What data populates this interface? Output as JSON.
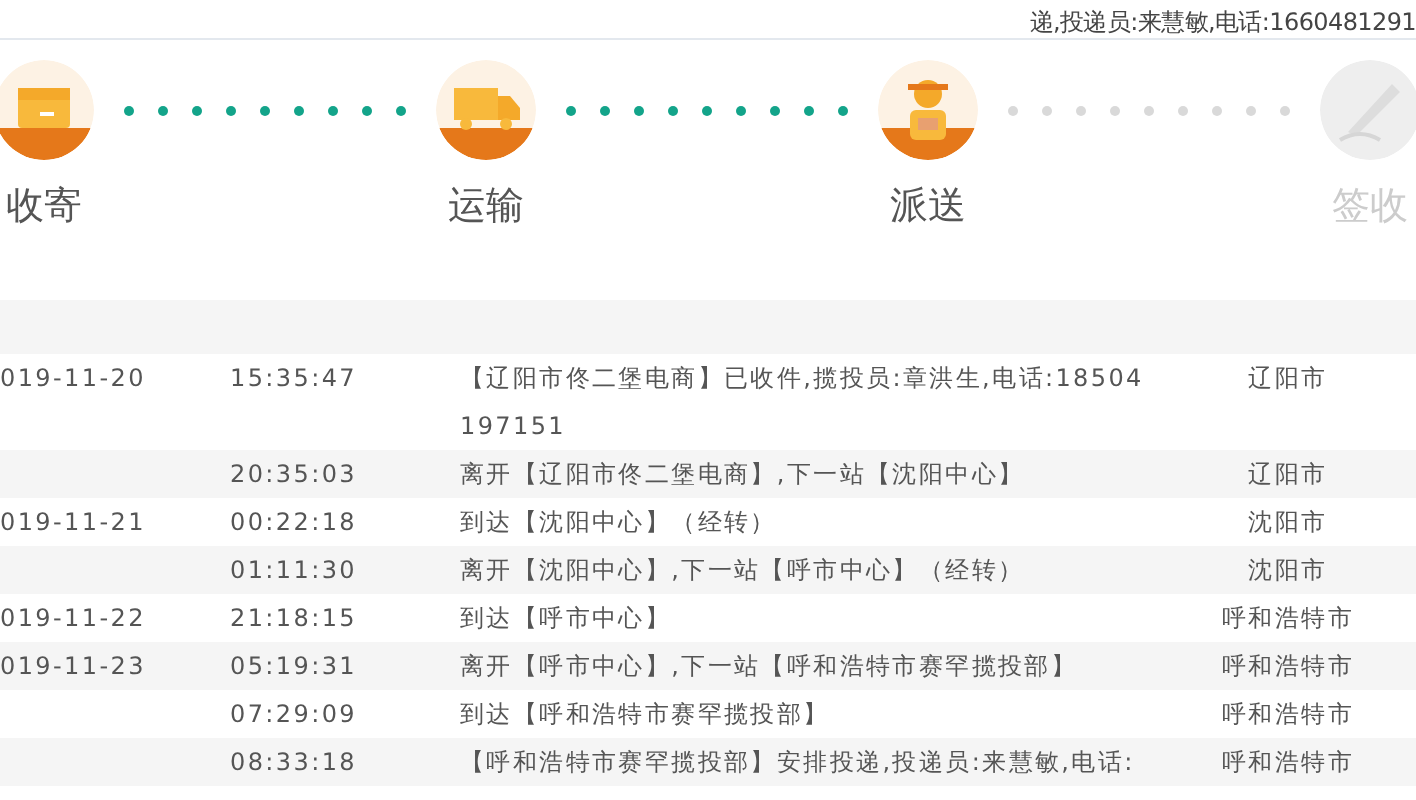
{
  "top_strip": {
    "text": "递,投递员:来慧敏,电话:1660481291"
  },
  "steps": [
    {
      "label": "收寄",
      "kind": "box",
      "done": true
    },
    {
      "label": "运输",
      "kind": "truck",
      "done": true
    },
    {
      "label": "派送",
      "kind": "courier",
      "done": true
    },
    {
      "label": "签收",
      "kind": "sign",
      "done": false
    }
  ],
  "table": {
    "rows": [
      {
        "date": "019-11-20",
        "time": "15:35:47",
        "description": "【辽阳市佟二堡电商】已收件,揽投员:章洪生,电话:18504197151",
        "city": "辽阳市"
      },
      {
        "time": "20:35:03",
        "description": "离开【辽阳市佟二堡电商】,下一站【沈阳中心】",
        "city": "辽阳市"
      },
      {
        "date": "019-11-21",
        "time": "00:22:18",
        "description": "到达【沈阳中心】（经转）",
        "city": "沈阳市"
      },
      {
        "time": "01:11:30",
        "description": "离开【沈阳中心】,下一站【呼市中心】（经转）",
        "city": "沈阳市"
      },
      {
        "date": "019-11-22",
        "time": "21:18:15",
        "description": "到达【呼市中心】",
        "city": "呼和浩特市"
      },
      {
        "date": "019-11-23",
        "time": "05:19:31",
        "description": "离开【呼市中心】,下一站【呼和浩特市赛罕揽投部】",
        "city": "呼和浩特市"
      },
      {
        "time": "07:29:09",
        "description": "到达【呼和浩特市赛罕揽投部】",
        "city": "呼和浩特市"
      },
      {
        "time": "08:33:18",
        "description": "【呼和浩特市赛罕揽投部】安排投递,投递员:来慧敏,电话:",
        "city": "呼和浩特市"
      }
    ]
  }
}
